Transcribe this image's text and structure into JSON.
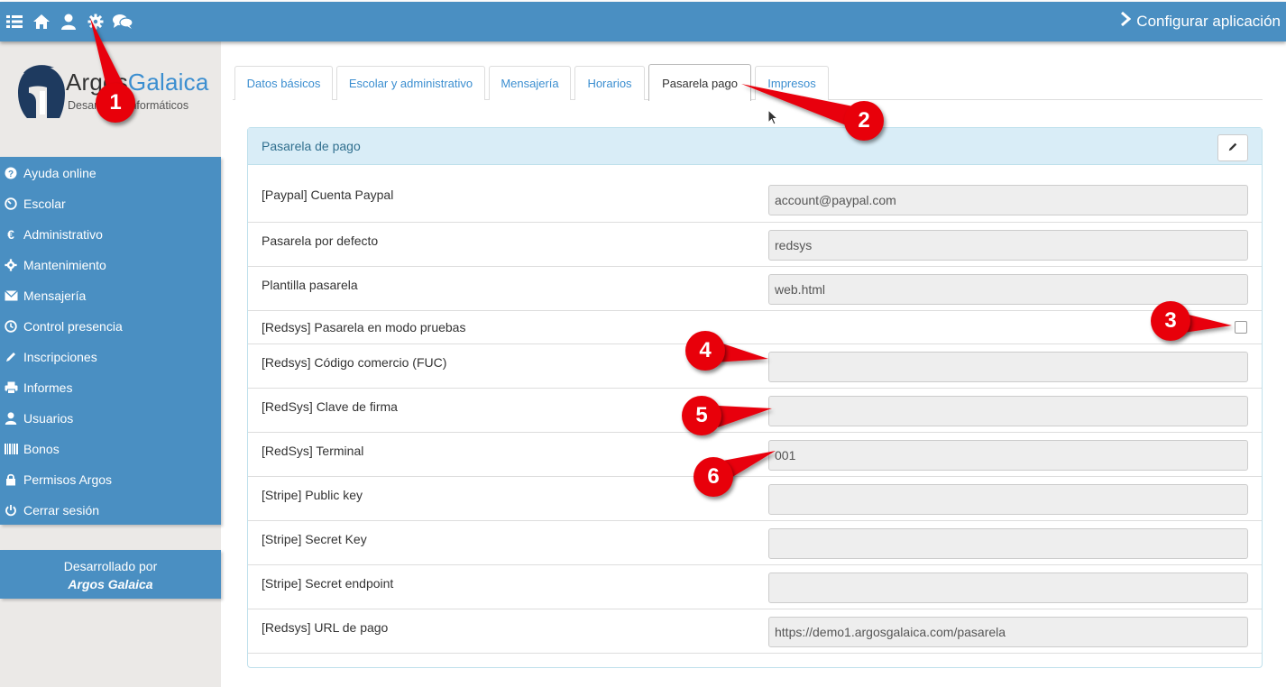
{
  "topbar": {
    "icons": [
      "list-icon",
      "home-icon",
      "user-icon",
      "gear-icon",
      "chat-icon"
    ],
    "config_label": "Configurar aplicación",
    "color": "#4a8fc2"
  },
  "logo": {
    "name_part1": "Argos",
    "name_part2": "Galaica",
    "tagline": "Desarrollos informáticos"
  },
  "sidebar": {
    "items": [
      {
        "label": "Ayuda online",
        "icon": "question-icon"
      },
      {
        "label": "Escolar",
        "icon": "dashboard-icon"
      },
      {
        "label": "Administrativo",
        "icon": "euro-icon"
      },
      {
        "label": "Mantenimiento",
        "icon": "gear-icon"
      },
      {
        "label": "Mensajería",
        "icon": "envelope-icon"
      },
      {
        "label": "Control presencia",
        "icon": "clock-icon"
      },
      {
        "label": "Inscripciones",
        "icon": "pencil-icon"
      },
      {
        "label": "Informes",
        "icon": "print-icon"
      },
      {
        "label": "Usuarios",
        "icon": "user-icon"
      },
      {
        "label": "Bonos",
        "icon": "barcode-icon"
      },
      {
        "label": "Permisos Argos",
        "icon": "lock-icon"
      },
      {
        "label": "Cerrar sesión",
        "icon": "power-icon"
      }
    ],
    "credit_line1": "Desarrollado por",
    "credit_line2": "Argos Galaica"
  },
  "tabs": [
    {
      "label": "Datos básicos",
      "active": false
    },
    {
      "label": "Escolar y administrativo",
      "active": false
    },
    {
      "label": "Mensajería",
      "active": false
    },
    {
      "label": "Horarios",
      "active": false
    },
    {
      "label": "Pasarela pago",
      "active": true
    },
    {
      "label": "Impresos",
      "active": false
    }
  ],
  "panel": {
    "title": "Pasarela de pago",
    "rows": [
      {
        "label": "[Paypal] Cuenta Paypal",
        "type": "text",
        "value": "account@paypal.com"
      },
      {
        "label": "Pasarela por defecto",
        "type": "text",
        "value": "redsys"
      },
      {
        "label": "Plantilla pasarela",
        "type": "text",
        "value": "web.html"
      },
      {
        "label": "[Redsys] Pasarela en modo pruebas",
        "type": "checkbox",
        "checked": false
      },
      {
        "label": "[Redsys] Código comercio (FUC)",
        "type": "text",
        "value": ""
      },
      {
        "label": "[RedSys] Clave de firma",
        "type": "text",
        "value": ""
      },
      {
        "label": "[RedSys] Terminal",
        "type": "text",
        "value": "001"
      },
      {
        "label": "[Stripe] Public key",
        "type": "text",
        "value": ""
      },
      {
        "label": "[Stripe] Secret Key",
        "type": "text",
        "value": ""
      },
      {
        "label": "[Stripe] Secret endpoint",
        "type": "text",
        "value": ""
      },
      {
        "label": "[Redsys] URL de pago",
        "type": "text",
        "value": "https://demo1.argosgalaica.com/pasarela"
      }
    ]
  },
  "callouts": [
    "1",
    "2",
    "3",
    "4",
    "5",
    "6"
  ],
  "callout_color": "#e8000a"
}
